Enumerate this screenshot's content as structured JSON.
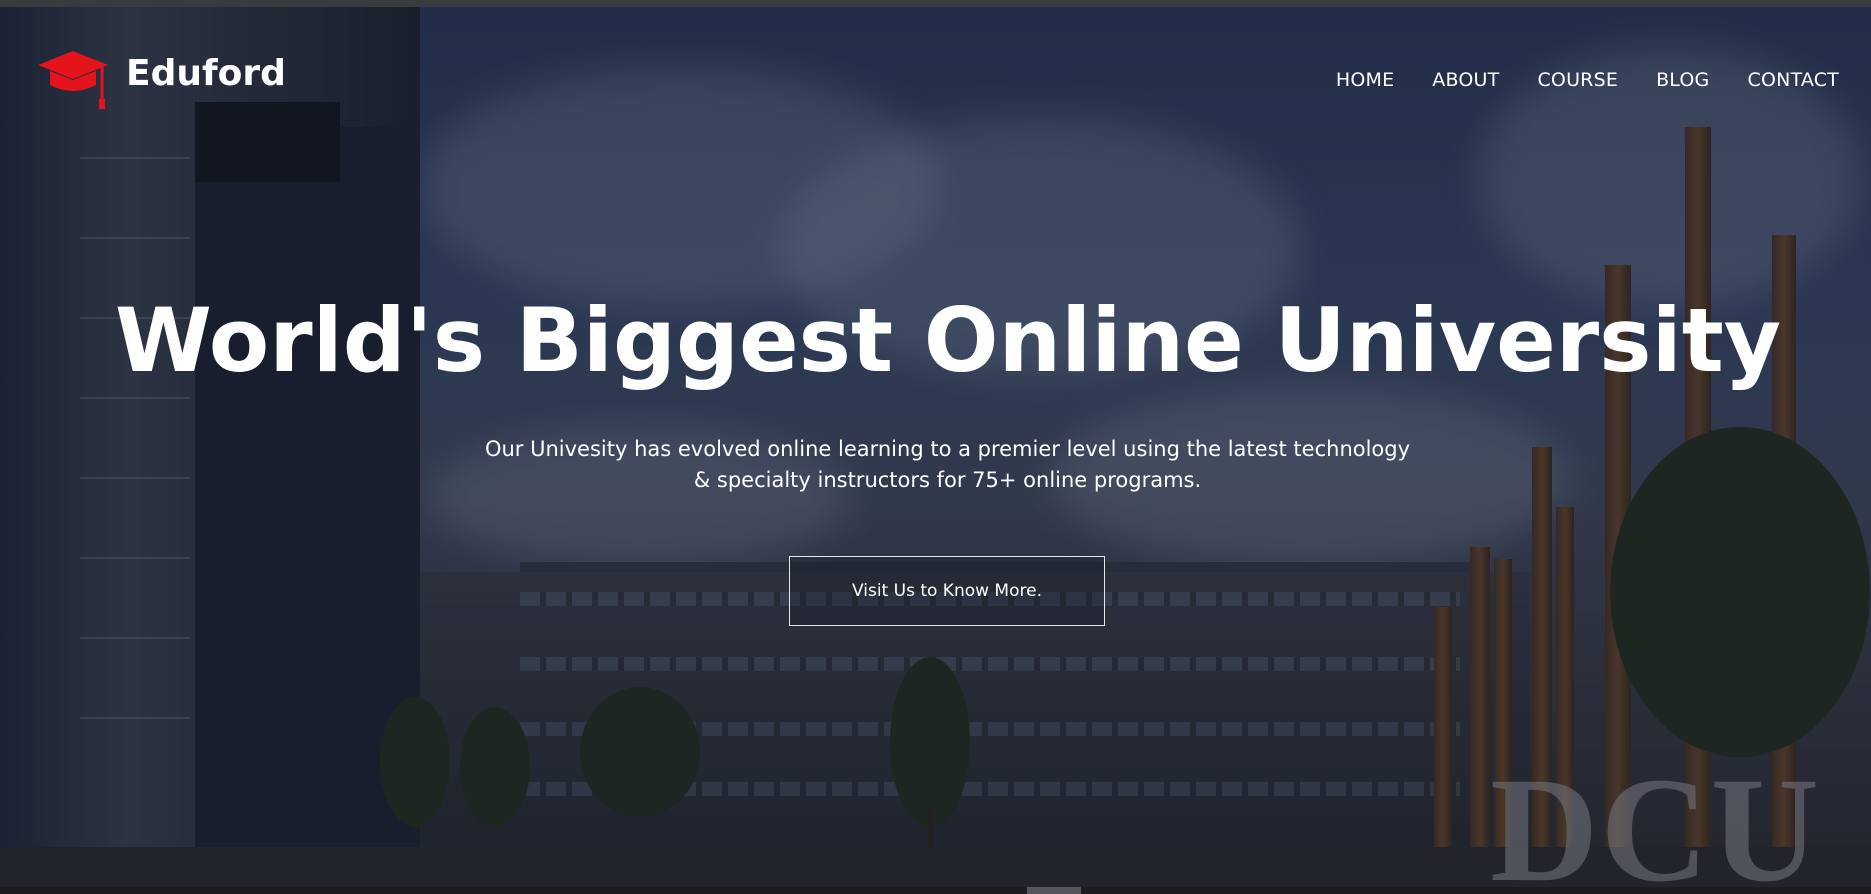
{
  "brand": {
    "name": "Eduford",
    "accent_color": "#e5131c",
    "icon": "graduation-cap-icon"
  },
  "nav": {
    "items": [
      {
        "label": "HOME"
      },
      {
        "label": "ABOUT"
      },
      {
        "label": "COURSE"
      },
      {
        "label": "BLOG"
      },
      {
        "label": "CONTACT"
      }
    ]
  },
  "hero": {
    "title": "World's Biggest Online University",
    "subtitle_line1": "Our Univesity has evolved online learning to a premier level using the latest technology",
    "subtitle_line2": "& specialty instructors for 75+ online programs.",
    "cta_label": "Visit Us to Know More.",
    "background_sign_text": "DCU"
  }
}
